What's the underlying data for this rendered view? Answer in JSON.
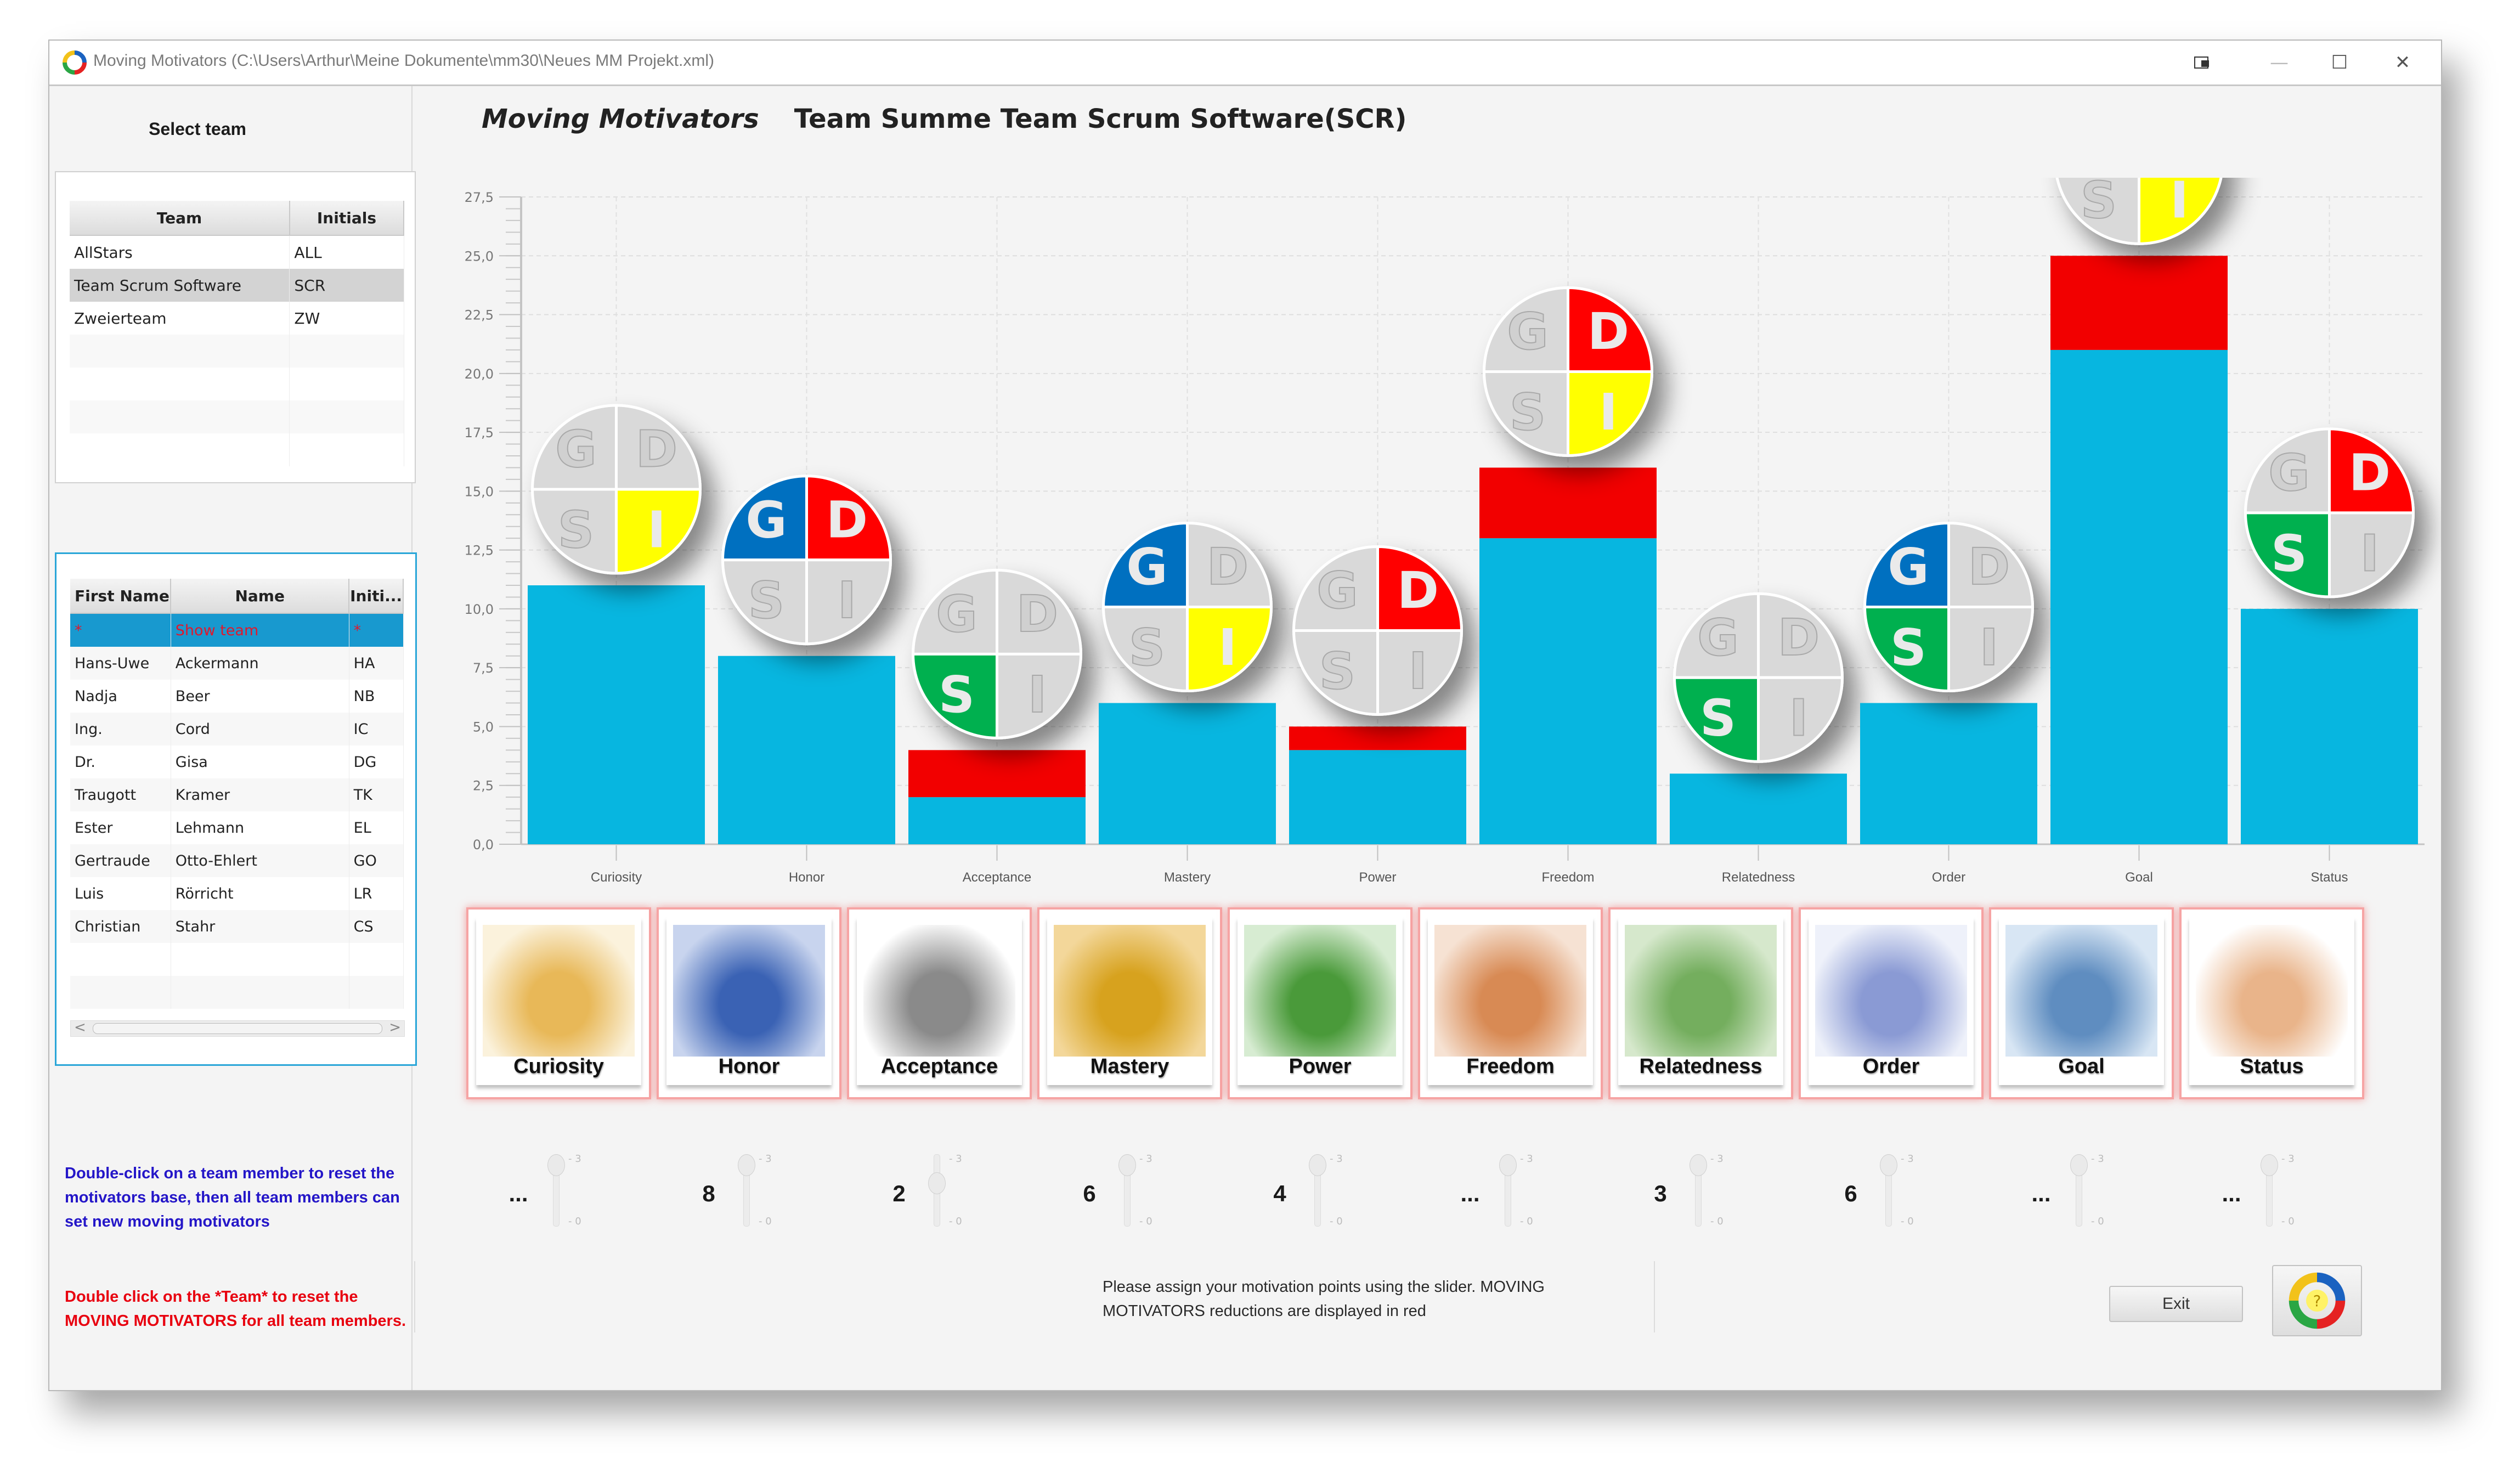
{
  "window": {
    "title": "Moving Motivators (C:\\Users\\Arthur\\Meine Dokumente\\mm30\\Neues MM Projekt.xml)",
    "controls": {
      "snap_icon": "snap-layout-icon",
      "minimize": "—",
      "maximize": "☐",
      "close": "✕"
    }
  },
  "left": {
    "select_team_label": "Select team",
    "team_table": {
      "headers": [
        "Team",
        "Initials"
      ],
      "rows": [
        {
          "team": "AllStars",
          "initials": "ALL",
          "selected": false
        },
        {
          "team": "Team Scrum Software",
          "initials": "SCR",
          "selected": true
        },
        {
          "team": "Zweierteam",
          "initials": "ZW",
          "selected": false
        }
      ]
    },
    "member_table": {
      "headers": [
        "First Name",
        "Name",
        "Initi..."
      ],
      "rows": [
        {
          "first": "*",
          "name": "Show team",
          "initials": "*",
          "selected": true
        },
        {
          "first": "Hans-Uwe",
          "name": "Ackermann",
          "initials": "HA"
        },
        {
          "first": "Nadja",
          "name": "Beer",
          "initials": "NB"
        },
        {
          "first": "Ing.",
          "name": "Cord",
          "initials": "IC"
        },
        {
          "first": "Dr.",
          "name": "Gisa",
          "initials": "DG"
        },
        {
          "first": "Traugott",
          "name": "Kramer",
          "initials": "TK"
        },
        {
          "first": "Ester",
          "name": "Lehmann",
          "initials": "EL"
        },
        {
          "first": "Gertraude",
          "name": "Otto-Ehlert",
          "initials": "GO"
        },
        {
          "first": "Luis",
          "name": "Rörricht",
          "initials": "LR"
        },
        {
          "first": "Christian",
          "name": "Stahr",
          "initials": "CS"
        }
      ],
      "scroll_left": "<",
      "scroll_right": ">"
    },
    "info_blue": "Double-click on a team member to reset the motivators base, then all team members can set new moving motivators",
    "info_red": "Double click on the *Team* to reset the MOVING MOTIVATORS for all team members."
  },
  "heading": {
    "app": "Moving Motivators",
    "team": "Team Summe Team Scrum Software(SCR)"
  },
  "chart_data": {
    "type": "bar",
    "stacked": true,
    "title": "",
    "xlabel": "",
    "ylabel": "",
    "ylim": [
      0,
      27.5
    ],
    "yticks": [
      "0,0",
      "2,5",
      "5,0",
      "7,5",
      "10,0",
      "12,5",
      "15,0",
      "17,5",
      "20,0",
      "22,5",
      "25,0",
      "27,5"
    ],
    "grid": true,
    "categories": [
      "Curiosity",
      "Honor",
      "Acceptance",
      "Mastery",
      "Power",
      "Freedom",
      "Relatedness",
      "Order",
      "Goal",
      "Status"
    ],
    "series": [
      {
        "name": "Motivation points",
        "color": "#07B6E0",
        "values": [
          11,
          8,
          2,
          6,
          4,
          13,
          3,
          6,
          21,
          10
        ]
      },
      {
        "name": "MOVING MOTIVATORS reductions",
        "color": "#F20000",
        "values": [
          0,
          0,
          2,
          0,
          1,
          3,
          0,
          0,
          4,
          0
        ]
      }
    ],
    "gdsi_badges": [
      {
        "G": false,
        "D": false,
        "S": false,
        "I": true
      },
      {
        "G": true,
        "D": true,
        "S": false,
        "I": false
      },
      {
        "G": false,
        "D": false,
        "S": true,
        "I": false
      },
      {
        "G": true,
        "D": false,
        "S": false,
        "I": true
      },
      {
        "G": false,
        "D": true,
        "S": false,
        "I": false
      },
      {
        "G": false,
        "D": true,
        "S": false,
        "I": true
      },
      {
        "G": false,
        "D": false,
        "S": true,
        "I": false
      },
      {
        "G": true,
        "D": false,
        "S": true,
        "I": false
      },
      {
        "G": true,
        "D": false,
        "S": false,
        "I": true
      },
      {
        "G": false,
        "D": true,
        "S": true,
        "I": false
      }
    ],
    "gdsi_colors": {
      "G": "#0070C0",
      "D": "#FF0000",
      "S": "#00B050",
      "I": "#FFFF00",
      "off": "#D9D9D9"
    }
  },
  "cards": [
    {
      "label": "Curiosity",
      "img": "person-at-desk",
      "colors": [
        "#fbf2dc",
        "#e8b858"
      ]
    },
    {
      "label": "Honor",
      "img": "medals",
      "colors": [
        "#c8d4ee",
        "#3a62b4"
      ]
    },
    {
      "label": "Acceptance",
      "img": "graduate",
      "colors": [
        "#ffffff",
        "#8a8a8a"
      ]
    },
    {
      "label": "Mastery",
      "img": "compass",
      "colors": [
        "#f3d79a",
        "#d7a21e"
      ]
    },
    {
      "label": "Power",
      "img": "handshake",
      "colors": [
        "#d7ecd2",
        "#4a9a3a"
      ]
    },
    {
      "label": "Freedom",
      "img": "statue-of-liberty",
      "colors": [
        "#f6e2d3",
        "#d88a54"
      ]
    },
    {
      "label": "Relatedness",
      "img": "people-group",
      "colors": [
        "#d6e8cc",
        "#74ae5e"
      ]
    },
    {
      "label": "Order",
      "img": "gears",
      "colors": [
        "#eef1fa",
        "#8a9ad4"
      ]
    },
    {
      "label": "Goal",
      "img": "summit-cross",
      "colors": [
        "#d8e6f4",
        "#5f8dc0"
      ]
    },
    {
      "label": "Status",
      "img": "person-on-pedestal",
      "colors": [
        "#ffffff",
        "#e9b48a"
      ]
    }
  ],
  "sliders": [
    {
      "value_label": "...",
      "value": 3,
      "max": "3",
      "min": "0"
    },
    {
      "value_label": "8",
      "value": 3,
      "max": "3",
      "min": "0"
    },
    {
      "value_label": "2",
      "value": 2,
      "max": "3",
      "min": "0"
    },
    {
      "value_label": "6",
      "value": 3,
      "max": "3",
      "min": "0"
    },
    {
      "value_label": "4",
      "value": 3,
      "max": "3",
      "min": "0"
    },
    {
      "value_label": "...",
      "value": 3,
      "max": "3",
      "min": "0"
    },
    {
      "value_label": "3",
      "value": 3,
      "max": "3",
      "min": "0"
    },
    {
      "value_label": "6",
      "value": 3,
      "max": "3",
      "min": "0"
    },
    {
      "value_label": "...",
      "value": 3,
      "max": "3",
      "min": "0"
    },
    {
      "value_label": "...",
      "value": 3,
      "max": "3",
      "min": "0"
    }
  ],
  "status": {
    "text": "Please assign your motivation points using the slider. MOVING MOTIVATORS reductions are displayed in red"
  },
  "buttons": {
    "exit": "Exit",
    "help_icon": "moving-motivators-logo-icon"
  }
}
